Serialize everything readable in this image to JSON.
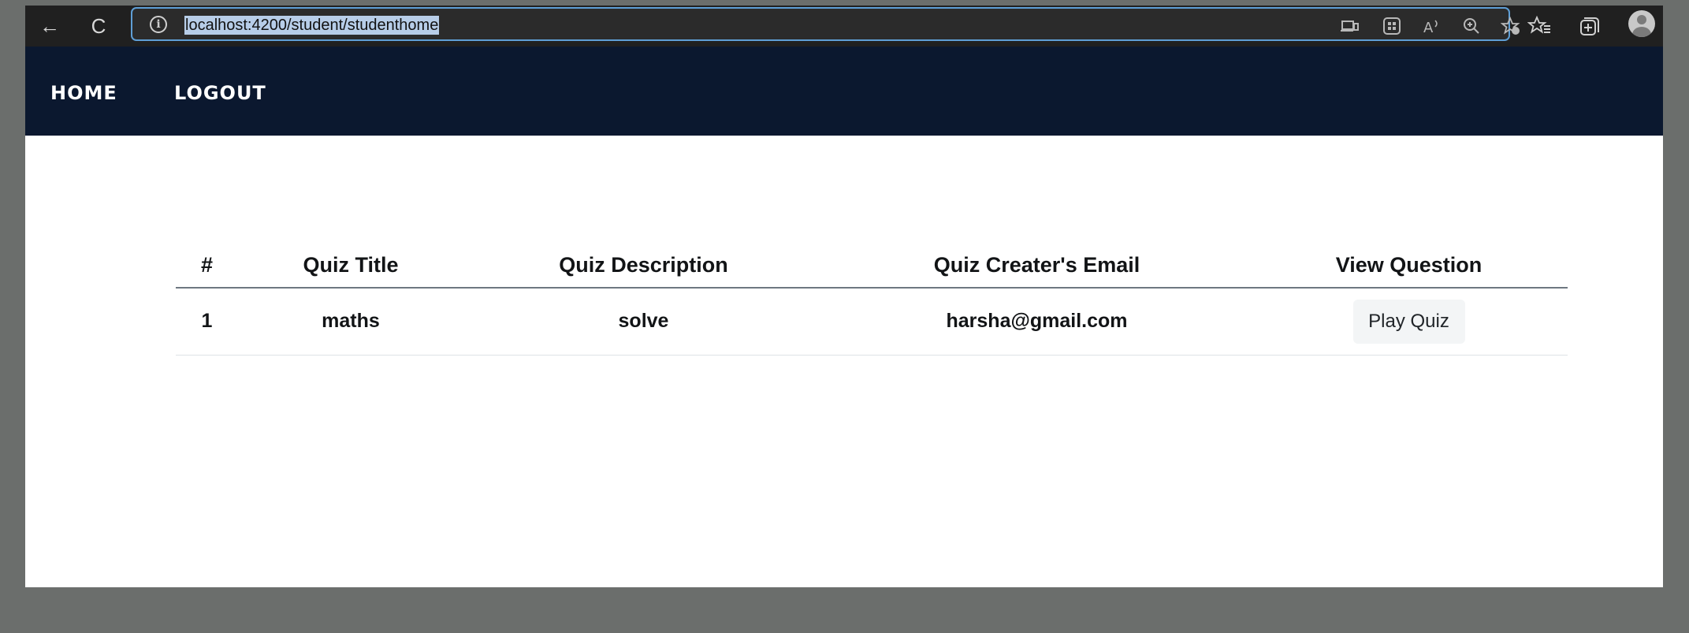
{
  "browser": {
    "back_icon": "←",
    "refresh_icon": "C",
    "info_icon": "i",
    "url": "localhost:4200/student/studenthome",
    "icons": [
      "device-icon",
      "apps-icon",
      "read-aloud-icon",
      "zoom-icon",
      "favorite-add-icon",
      "favorites-icon",
      "collections-icon",
      "profile-icon"
    ]
  },
  "nav": {
    "home": "HOME",
    "logout": "LOGOUT"
  },
  "table": {
    "headers": [
      "#",
      "Quiz Title",
      "Quiz Description",
      "Quiz Creater's Email",
      "View Question"
    ],
    "rows": [
      {
        "num": "1",
        "title": "maths",
        "description": "solve",
        "email": "harsha@gmail.com",
        "action": "Play Quiz"
      }
    ]
  },
  "colors": {
    "navbar": "#0b182f",
    "browser_chrome": "#202020",
    "address_border": "#5f9fd6"
  }
}
